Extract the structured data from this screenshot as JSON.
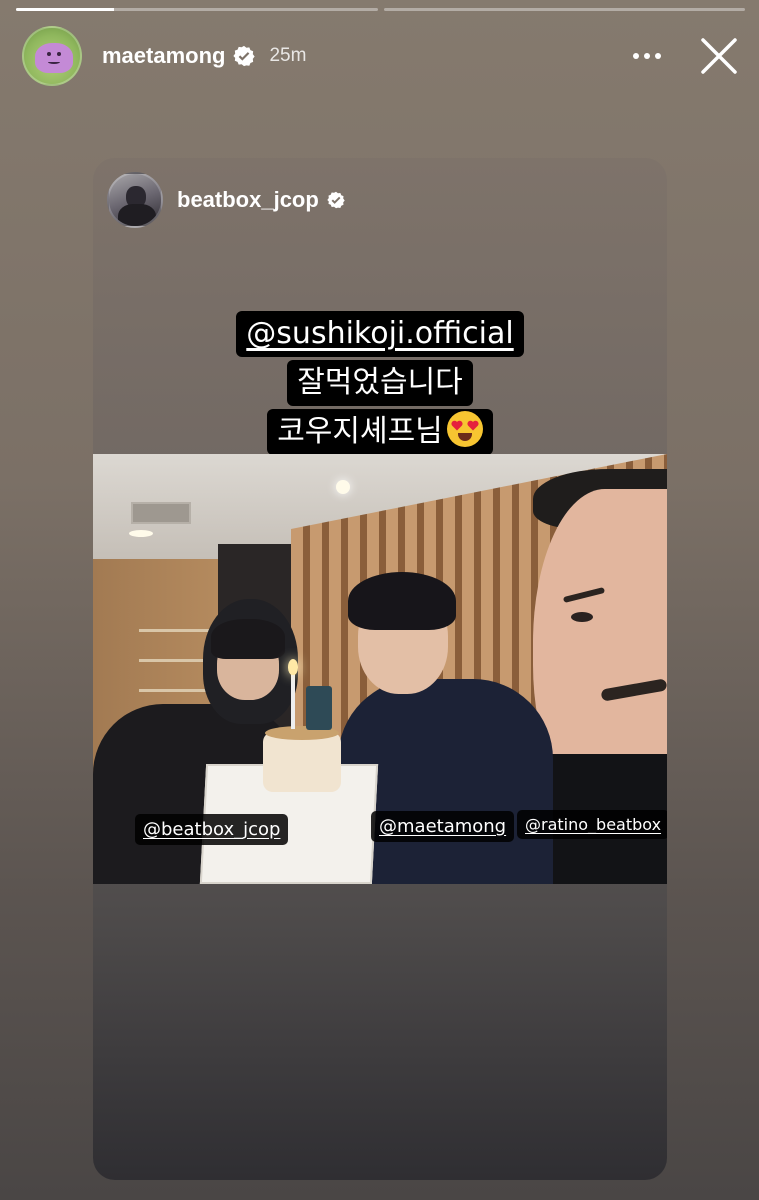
{
  "story": {
    "progress": [
      1.0,
      0.0
    ],
    "progress_current_fill": 0.27,
    "username": "maetamong",
    "time_ago": "25m",
    "avatar_icon": "ditto-avatar-icon",
    "more_icon": "more-horizontal-icon",
    "close_icon": "close-icon"
  },
  "shared_post": {
    "username": "beatbox_jcop",
    "caption_lines": [
      "@sushikoji.official",
      "잘먹었습니다",
      "코우지셰프님"
    ],
    "caption_emoji": "heart-eyes-emoji",
    "tags": [
      "@beatbox_jcop",
      "@maetamong",
      "@ratino_beatbox"
    ]
  },
  "colors": {
    "verified_blue": "#ffffff",
    "background_top": "#857a6e",
    "background_bottom": "#4a4645"
  }
}
